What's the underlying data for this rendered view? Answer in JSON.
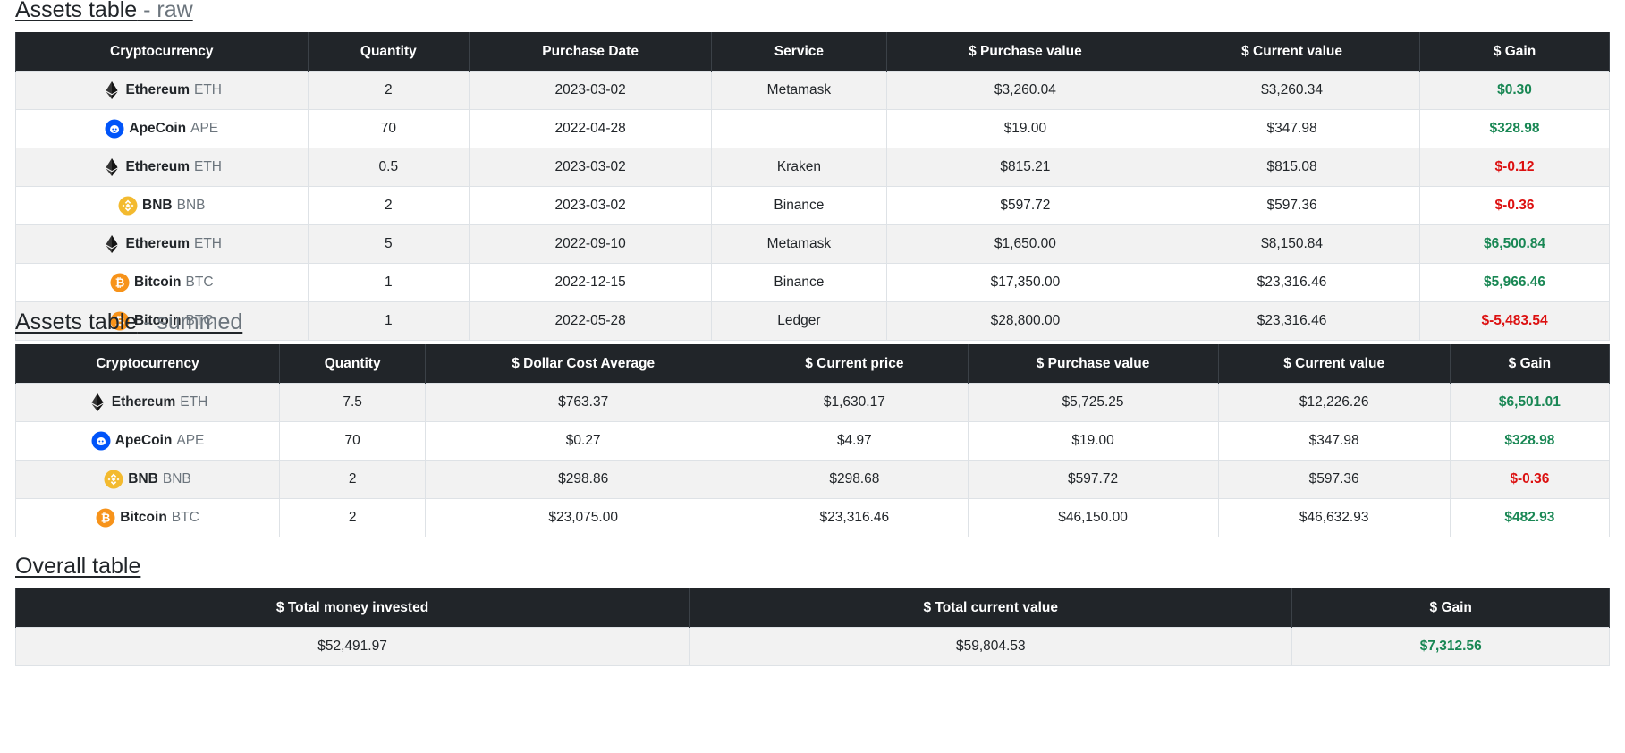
{
  "raw": {
    "heading_main": "Assets table",
    "heading_sub": " - raw",
    "columns": [
      "Cryptocurrency",
      "Quantity",
      "Purchase Date",
      "Service",
      "$ Purchase value",
      "$ Current value",
      "$ Gain"
    ],
    "rows": [
      {
        "icon": "ethereum-icon",
        "name": "Ethereum",
        "symbol": "ETH",
        "quantity": "2",
        "date": "2023-03-02",
        "service": "Metamask",
        "purchase": "$3,260.04",
        "current": "$3,260.34",
        "gain": "$0.30",
        "gain_sign": "pos"
      },
      {
        "icon": "apecoin-icon",
        "name": "ApeCoin",
        "symbol": "APE",
        "quantity": "70",
        "date": "2022-04-28",
        "service": "",
        "purchase": "$19.00",
        "current": "$347.98",
        "gain": "$328.98",
        "gain_sign": "pos"
      },
      {
        "icon": "ethereum-icon",
        "name": "Ethereum",
        "symbol": "ETH",
        "quantity": "0.5",
        "date": "2023-03-02",
        "service": "Kraken",
        "purchase": "$815.21",
        "current": "$815.08",
        "gain": "$-0.12",
        "gain_sign": "neg"
      },
      {
        "icon": "bnb-icon",
        "name": "BNB",
        "symbol": "BNB",
        "quantity": "2",
        "date": "2023-03-02",
        "service": "Binance",
        "purchase": "$597.72",
        "current": "$597.36",
        "gain": "$-0.36",
        "gain_sign": "neg"
      },
      {
        "icon": "ethereum-icon",
        "name": "Ethereum",
        "symbol": "ETH",
        "quantity": "5",
        "date": "2022-09-10",
        "service": "Metamask",
        "purchase": "$1,650.00",
        "current": "$8,150.84",
        "gain": "$6,500.84",
        "gain_sign": "pos"
      },
      {
        "icon": "bitcoin-icon",
        "name": "Bitcoin",
        "symbol": "BTC",
        "quantity": "1",
        "date": "2022-12-15",
        "service": "Binance",
        "purchase": "$17,350.00",
        "current": "$23,316.46",
        "gain": "$5,966.46",
        "gain_sign": "pos"
      },
      {
        "icon": "bitcoin-icon",
        "name": "Bitcoin",
        "symbol": "BTC",
        "quantity": "1",
        "date": "2022-05-28",
        "service": "Ledger",
        "purchase": "$28,800.00",
        "current": "$23,316.46",
        "gain": "$-5,483.54",
        "gain_sign": "neg"
      }
    ]
  },
  "summed": {
    "heading_main": "Assets table",
    "heading_sub": " - summed",
    "columns": [
      "Cryptocurrency",
      "Quantity",
      "$ Dollar Cost Average",
      "$ Current price",
      "$ Purchase value",
      "$ Current value",
      "$ Gain"
    ],
    "rows": [
      {
        "icon": "ethereum-icon",
        "name": "Ethereum",
        "symbol": "ETH",
        "quantity": "7.5",
        "dca": "$763.37",
        "price": "$1,630.17",
        "purchase": "$5,725.25",
        "current": "$12,226.26",
        "gain": "$6,501.01",
        "gain_sign": "pos"
      },
      {
        "icon": "apecoin-icon",
        "name": "ApeCoin",
        "symbol": "APE",
        "quantity": "70",
        "dca": "$0.27",
        "price": "$4.97",
        "purchase": "$19.00",
        "current": "$347.98",
        "gain": "$328.98",
        "gain_sign": "pos"
      },
      {
        "icon": "bnb-icon",
        "name": "BNB",
        "symbol": "BNB",
        "quantity": "2",
        "dca": "$298.86",
        "price": "$298.68",
        "purchase": "$597.72",
        "current": "$597.36",
        "gain": "$-0.36",
        "gain_sign": "neg"
      },
      {
        "icon": "bitcoin-icon",
        "name": "Bitcoin",
        "symbol": "BTC",
        "quantity": "2",
        "dca": "$23,075.00",
        "price": "$23,316.46",
        "purchase": "$46,150.00",
        "current": "$46,632.93",
        "gain": "$482.93",
        "gain_sign": "pos"
      }
    ]
  },
  "overall": {
    "heading": "Overall table",
    "columns": [
      "$ Total money invested",
      "$ Total current value",
      "$ Gain"
    ],
    "row": {
      "invested": "$52,491.97",
      "current": "$59,804.53",
      "gain": "$7,312.56",
      "gain_sign": "pos"
    }
  },
  "colors": {
    "header_bg": "#212529",
    "stripe": "#f2f2f2",
    "gain_positive": "#198754",
    "gain_negative": "#dc1010",
    "ethereum": "#343434",
    "apecoin": "#0054f9",
    "bnb": "#f3ba2f",
    "bitcoin": "#f7931a"
  }
}
